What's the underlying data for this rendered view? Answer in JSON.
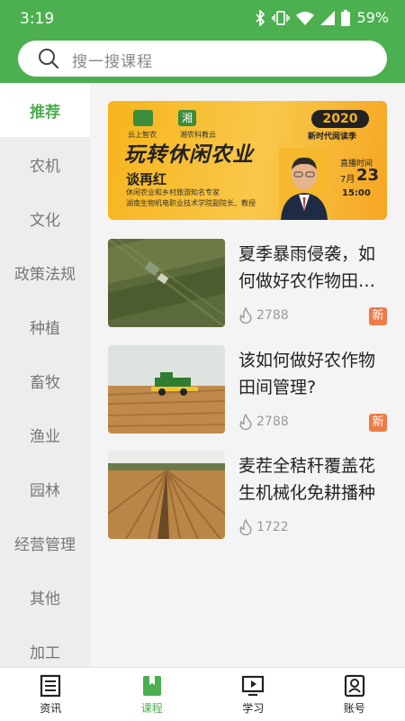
{
  "status_bar": {
    "time": "3:19",
    "battery": "59%"
  },
  "search": {
    "placeholder": "搜一搜课程"
  },
  "sidebar": {
    "items": [
      {
        "label": "推荐",
        "active": true
      },
      {
        "label": "农机",
        "active": false
      },
      {
        "label": "文化",
        "active": false
      },
      {
        "label": "政策法规",
        "active": false
      },
      {
        "label": "种植",
        "active": false
      },
      {
        "label": "畜牧",
        "active": false
      },
      {
        "label": "渔业",
        "active": false
      },
      {
        "label": "园林",
        "active": false
      },
      {
        "label": "经营管理",
        "active": false
      },
      {
        "label": "其他",
        "active": false
      },
      {
        "label": "加工",
        "active": false
      }
    ]
  },
  "banner": {
    "source1": "云上智农",
    "logo2": "湘",
    "source2": "湘农科教云",
    "title": "玩转休闲农业",
    "year": "2020",
    "season": "新时代阅读季",
    "speaker": "谈再红",
    "desc1": "休闲农业和乡村旅游知名专家",
    "desc2": "湖南生物机电职业技术学院副院长、教授",
    "live_label": "直播时间",
    "month": "7月",
    "day": "23",
    "clock": "15:00"
  },
  "courses": [
    {
      "title": "夏季暴雨侵袭，如何做好农作物田…",
      "views": "2788",
      "badge": "新"
    },
    {
      "title": "该如何做好农作物田间管理?",
      "views": "2788",
      "badge": "新"
    },
    {
      "title": "麦茬全秸秆覆盖花生机械化免耕播种",
      "views": "1722",
      "badge": ""
    }
  ],
  "bottom_nav": {
    "items": [
      {
        "label": "资讯",
        "icon": "news-icon",
        "active": false
      },
      {
        "label": "课程",
        "icon": "bookmark-icon",
        "active": true
      },
      {
        "label": "学习",
        "icon": "video-icon",
        "active": false
      },
      {
        "label": "账号",
        "icon": "account-icon",
        "active": false
      }
    ]
  },
  "colors": {
    "brand": "#4caf50",
    "badge": "#f07b47"
  }
}
